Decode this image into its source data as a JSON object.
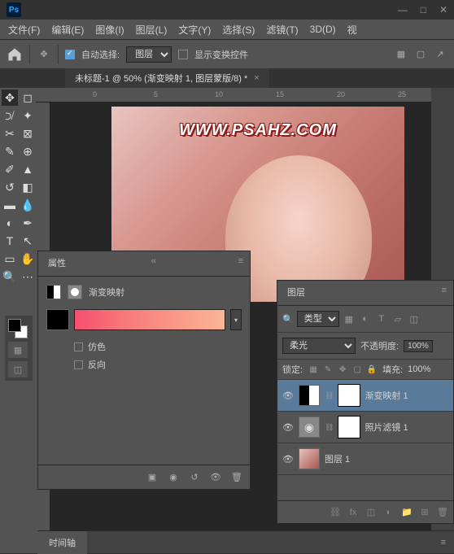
{
  "app": {
    "short": "Ps"
  },
  "menu": [
    "文件(F)",
    "编辑(E)",
    "图像(I)",
    "图层(L)",
    "文字(Y)",
    "选择(S)",
    "滤镜(T)",
    "3D(D)",
    "视"
  ],
  "options": {
    "auto_select_label": "自动选择:",
    "target": "图层",
    "show_transform_label": "显示变换控件"
  },
  "doc_tab": {
    "title": "未标题-1 @ 50% (渐变映射 1, 图层蒙版/8) *"
  },
  "ruler": {
    "ticks": [
      "0",
      "5",
      "10",
      "15",
      "20",
      "25"
    ]
  },
  "watermark": "WWW.PSAHZ.COM",
  "properties": {
    "panel_title": "属性",
    "adj_name": "渐变映射",
    "dither_label": "仿色",
    "reverse_label": "反向",
    "gradient_stops": [
      "#f54f6e",
      "#fbb694"
    ]
  },
  "layers": {
    "panel_title": "图层",
    "filter_label": "类型",
    "blend_mode": "柔光",
    "opacity_label": "不透明度:",
    "opacity_value": "100%",
    "lock_label": "锁定:",
    "fill_label": "填充:",
    "fill_value": "100%",
    "items": [
      {
        "name": "渐变映射 1"
      },
      {
        "name": "照片滤镜 1"
      },
      {
        "name": "图层 1"
      }
    ]
  },
  "timeline": {
    "title": "时间轴"
  }
}
